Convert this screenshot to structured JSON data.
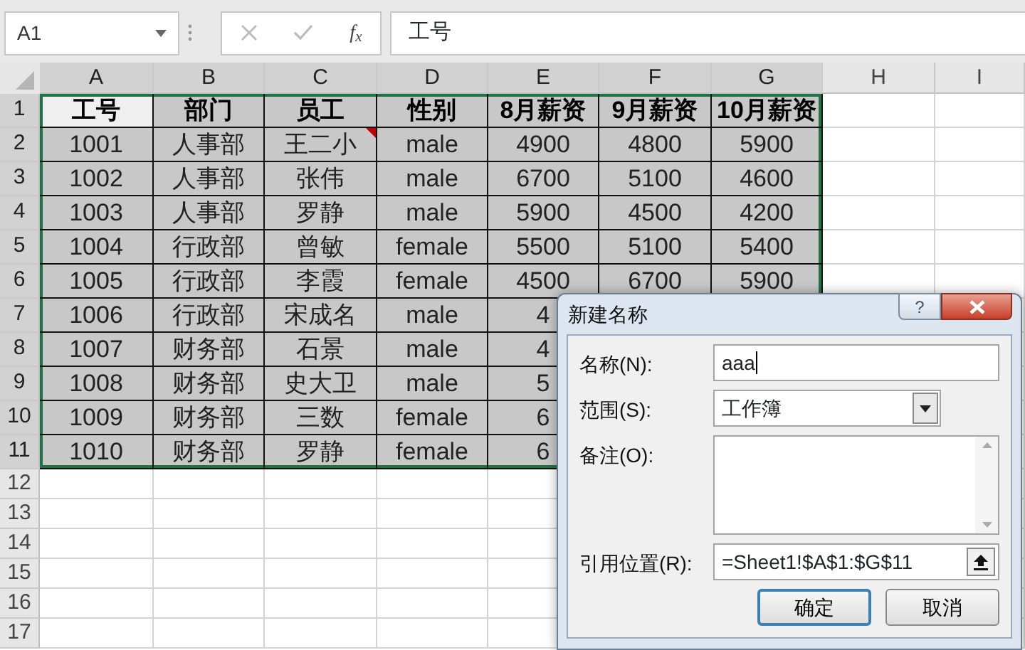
{
  "formula_bar": {
    "name_box": "A1",
    "function_button": "f$_{x}$",
    "formula": "工号"
  },
  "sheet": {
    "columns": [
      {
        "label": "A",
        "selected": true
      },
      {
        "label": "B",
        "selected": true
      },
      {
        "label": "C",
        "selected": true
      },
      {
        "label": "D",
        "selected": true
      },
      {
        "label": "E",
        "selected": true
      },
      {
        "label": "F",
        "selected": true
      },
      {
        "label": "G",
        "selected": true
      },
      {
        "label": "H",
        "selected": false
      },
      {
        "label": "I",
        "selected": false
      }
    ],
    "rows": [
      {
        "number": "1",
        "selected": true,
        "active_cells": [
          true,
          false,
          false,
          false,
          false,
          false,
          false
        ],
        "kind": "header",
        "cells": [
          "工号",
          "部门",
          "员工",
          "性别",
          "8月薪资",
          "9月薪资",
          "10月薪资"
        ]
      },
      {
        "number": "2",
        "selected": true,
        "kind": "data",
        "comment_cells": [
          false,
          false,
          true,
          false,
          false,
          false,
          false
        ],
        "cells": [
          "1001",
          "人事部",
          "王二小",
          "male",
          "4900",
          "4800",
          "5900"
        ]
      },
      {
        "number": "3",
        "selected": true,
        "kind": "data",
        "cells": [
          "1002",
          "人事部",
          "张伟",
          "male",
          "6700",
          "5100",
          "4600"
        ]
      },
      {
        "number": "4",
        "selected": true,
        "kind": "data",
        "cells": [
          "1003",
          "人事部",
          "罗静",
          "male",
          "5900",
          "4500",
          "4200"
        ]
      },
      {
        "number": "5",
        "selected": true,
        "kind": "data",
        "cells": [
          "1004",
          "行政部",
          "曾敏",
          "female",
          "5500",
          "5100",
          "5400"
        ]
      },
      {
        "number": "6",
        "selected": true,
        "kind": "data",
        "cells": [
          "1005",
          "行政部",
          "李霞",
          "female",
          "4500",
          "6700",
          "5900"
        ]
      },
      {
        "number": "7",
        "selected": true,
        "kind": "data",
        "cells": [
          "1006",
          "行政部",
          "宋成名",
          "male",
          "4"
        ]
      },
      {
        "number": "8",
        "selected": true,
        "kind": "data",
        "cells": [
          "1007",
          "财务部",
          "石景",
          "male",
          "4"
        ]
      },
      {
        "number": "9",
        "selected": true,
        "kind": "data",
        "cells": [
          "1008",
          "财务部",
          "史大卫",
          "male",
          "5"
        ]
      },
      {
        "number": "10",
        "selected": true,
        "kind": "data",
        "cells": [
          "1009",
          "财务部",
          "三数",
          "female",
          "6"
        ]
      },
      {
        "number": "11",
        "selected": true,
        "kind": "data",
        "cells": [
          "1010",
          "财务部",
          "罗静",
          "female",
          "6"
        ]
      },
      {
        "number": "12",
        "selected": false,
        "kind": "empty"
      },
      {
        "number": "13",
        "selected": false,
        "kind": "empty"
      },
      {
        "number": "14",
        "selected": false,
        "kind": "empty"
      },
      {
        "number": "15",
        "selected": false,
        "kind": "empty"
      },
      {
        "number": "16",
        "selected": false,
        "kind": "empty"
      },
      {
        "number": "17",
        "selected": false,
        "kind": "empty"
      }
    ]
  },
  "dialog": {
    "title": "新建名称",
    "help_button": "?",
    "fields": [
      {
        "kind": "text",
        "label": "名称(N):",
        "value": "aaa"
      },
      {
        "kind": "select",
        "label": "范围(S):",
        "value": "工作簿"
      },
      {
        "kind": "memo",
        "label": "备注(O):"
      },
      {
        "kind": "reference",
        "label": "引用位置(R):",
        "value": "=Sheet1!$A$1:$G$11"
      }
    ],
    "buttons": [
      {
        "label": "确定",
        "default": true
      },
      {
        "label": "取消",
        "default": false
      }
    ]
  }
}
